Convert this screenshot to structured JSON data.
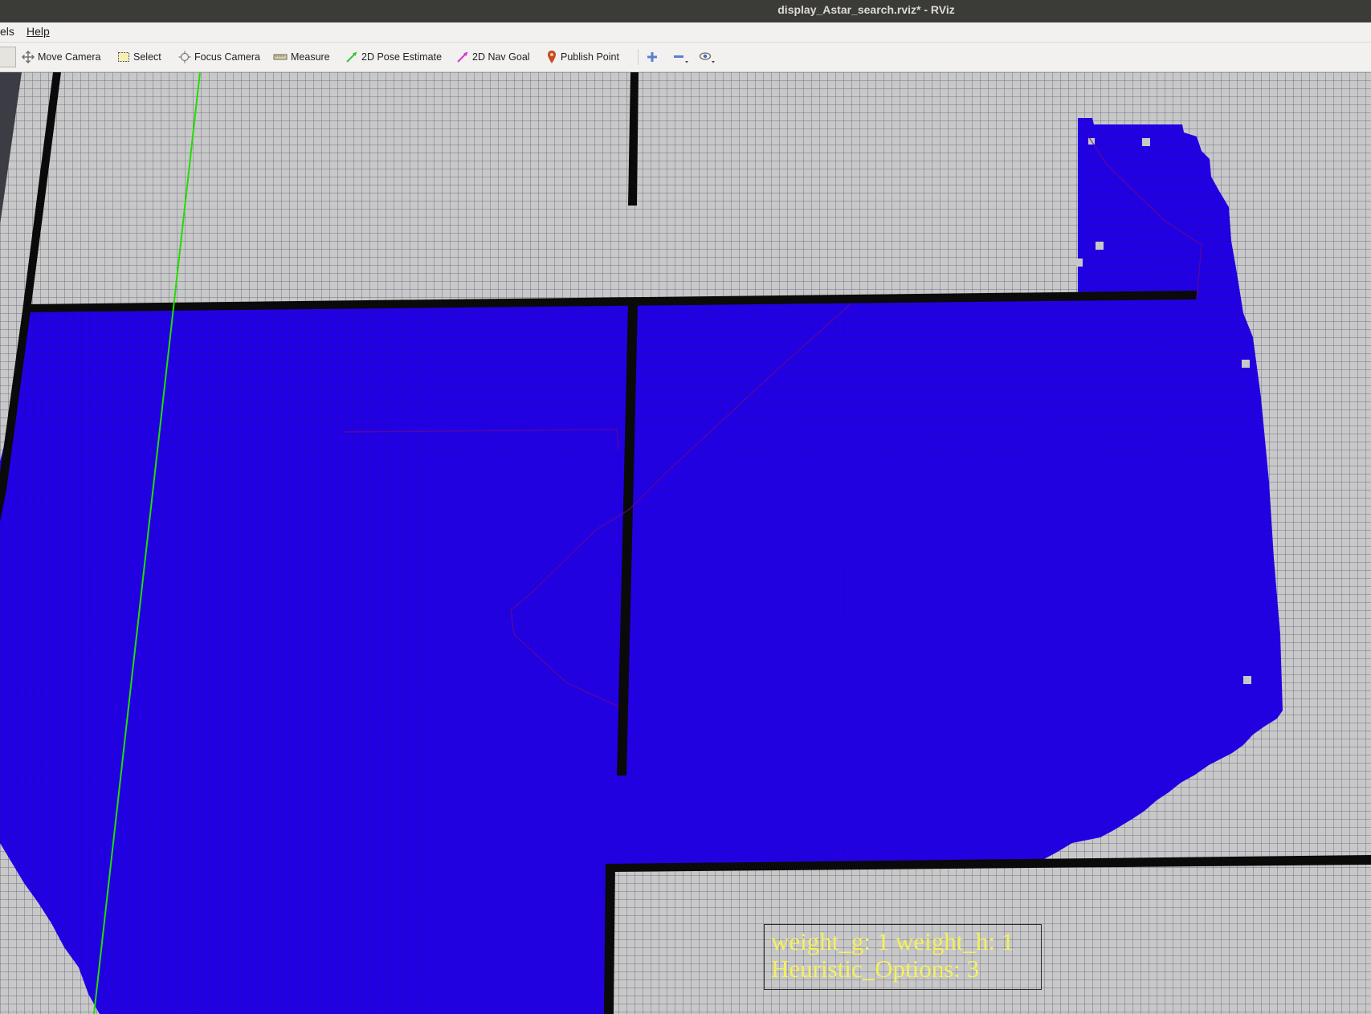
{
  "window": {
    "title": "display_Astar_search.rviz* - RViz"
  },
  "menu": {
    "items": [
      {
        "label": "els"
      },
      {
        "label": "Help"
      }
    ]
  },
  "toolbar": {
    "tools": [
      {
        "label": "Move Camera",
        "icon": "move-camera-icon"
      },
      {
        "label": "Select",
        "icon": "select-icon"
      },
      {
        "label": "Focus Camera",
        "icon": "focus-camera-icon"
      },
      {
        "label": "Measure",
        "icon": "measure-icon"
      },
      {
        "label": "2D Pose Estimate",
        "icon": "pose-estimate-icon"
      },
      {
        "label": "2D Nav Goal",
        "icon": "nav-goal-icon"
      },
      {
        "label": "Publish Point",
        "icon": "publish-point-icon"
      }
    ],
    "extra_icons": [
      "add-tool-icon",
      "remove-tool-icon",
      "camera-type-icon"
    ]
  },
  "viewport": {
    "overlay": {
      "line1": "weight_g: 1 weight_h: 1",
      "line2": "Heuristic_Options: 3"
    },
    "colors": {
      "free_cell": "#c8c8c8",
      "grid_line": "#6f7288",
      "explored_cell": "#2200e6",
      "obstacle": "#0a0a0a",
      "axis_line": "#22dd00",
      "path_line": "#6a0a8c",
      "overlay_text": "#f4f060"
    }
  }
}
